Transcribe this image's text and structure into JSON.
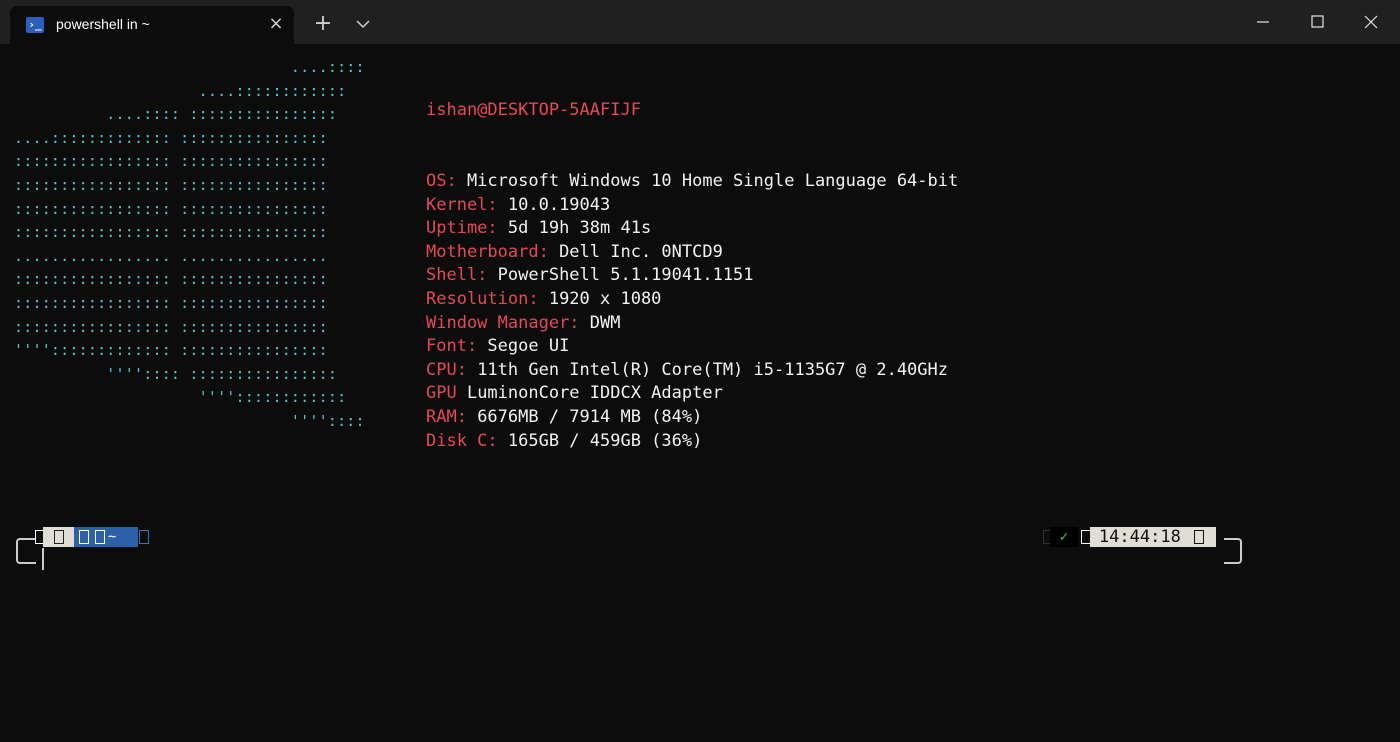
{
  "titlebar": {
    "tab_title": "powershell in ~",
    "tab_icon": "powershell-icon",
    "close_tab_label": "×",
    "new_tab_label": "+",
    "dropdown_icon": "chevron-down-icon"
  },
  "window_controls": {
    "minimize": "minimize-icon",
    "maximize": "maximize-icon",
    "close": "close-icon"
  },
  "ascii_logo": "                              ....::::\n                    ....::::::::::::\n          ....:::: ::::::::::::::::\n....::::::::::::: ::::::::::::::::\n::::::::::::::::: ::::::::::::::::\n::::::::::::::::: ::::::::::::::::\n::::::::::::::::: ::::::::::::::::\n::::::::::::::::: ::::::::::::::::\n................. ................\n::::::::::::::::: ::::::::::::::::\n::::::::::::::::: ::::::::::::::::\n::::::::::::::::: ::::::::::::::::\n''''::::::::::::: ::::::::::::::::\n          '''':::: ::::::::::::::::\n                    ''''::::::::::::\n                              ''''::::",
  "sysinfo": {
    "user_host": "ishan@DESKTOP-5AAFIJF",
    "rows": [
      {
        "label": "OS:",
        "value": " Microsoft Windows 10 Home Single Language 64-bit"
      },
      {
        "label": "Kernel:",
        "value": " 10.0.19043"
      },
      {
        "label": "Uptime:",
        "value": " 5d 19h 38m 41s"
      },
      {
        "label": "Motherboard:",
        "value": " Dell Inc. 0NTCD9"
      },
      {
        "label": "Shell:",
        "value": " PowerShell 5.1.19041.1151"
      },
      {
        "label": "Resolution:",
        "value": " 1920 x 1080"
      },
      {
        "label": "Window Manager:",
        "value": " DWM"
      },
      {
        "label": "Font:",
        "value": " Segoe UI"
      },
      {
        "label": "CPU:",
        "value": " 11th Gen Intel(R) Core(TM) i5-1135G7 @ 2.40GHz"
      },
      {
        "label": "GPU",
        "value": " LuminonCore IDDCX Adapter"
      },
      {
        "label": "RAM:",
        "value": " 6676MB / 7914 MB (84%)"
      },
      {
        "label": "Disk C:",
        "value": " 165GB / 459GB (36%)"
      }
    ]
  },
  "prompt": {
    "path": "~",
    "status_check": "✓",
    "time": "14:44:18"
  },
  "colors": {
    "label": "#e74856",
    "logo": "#4ec9d1",
    "path_segment": "#2e5fa9"
  }
}
